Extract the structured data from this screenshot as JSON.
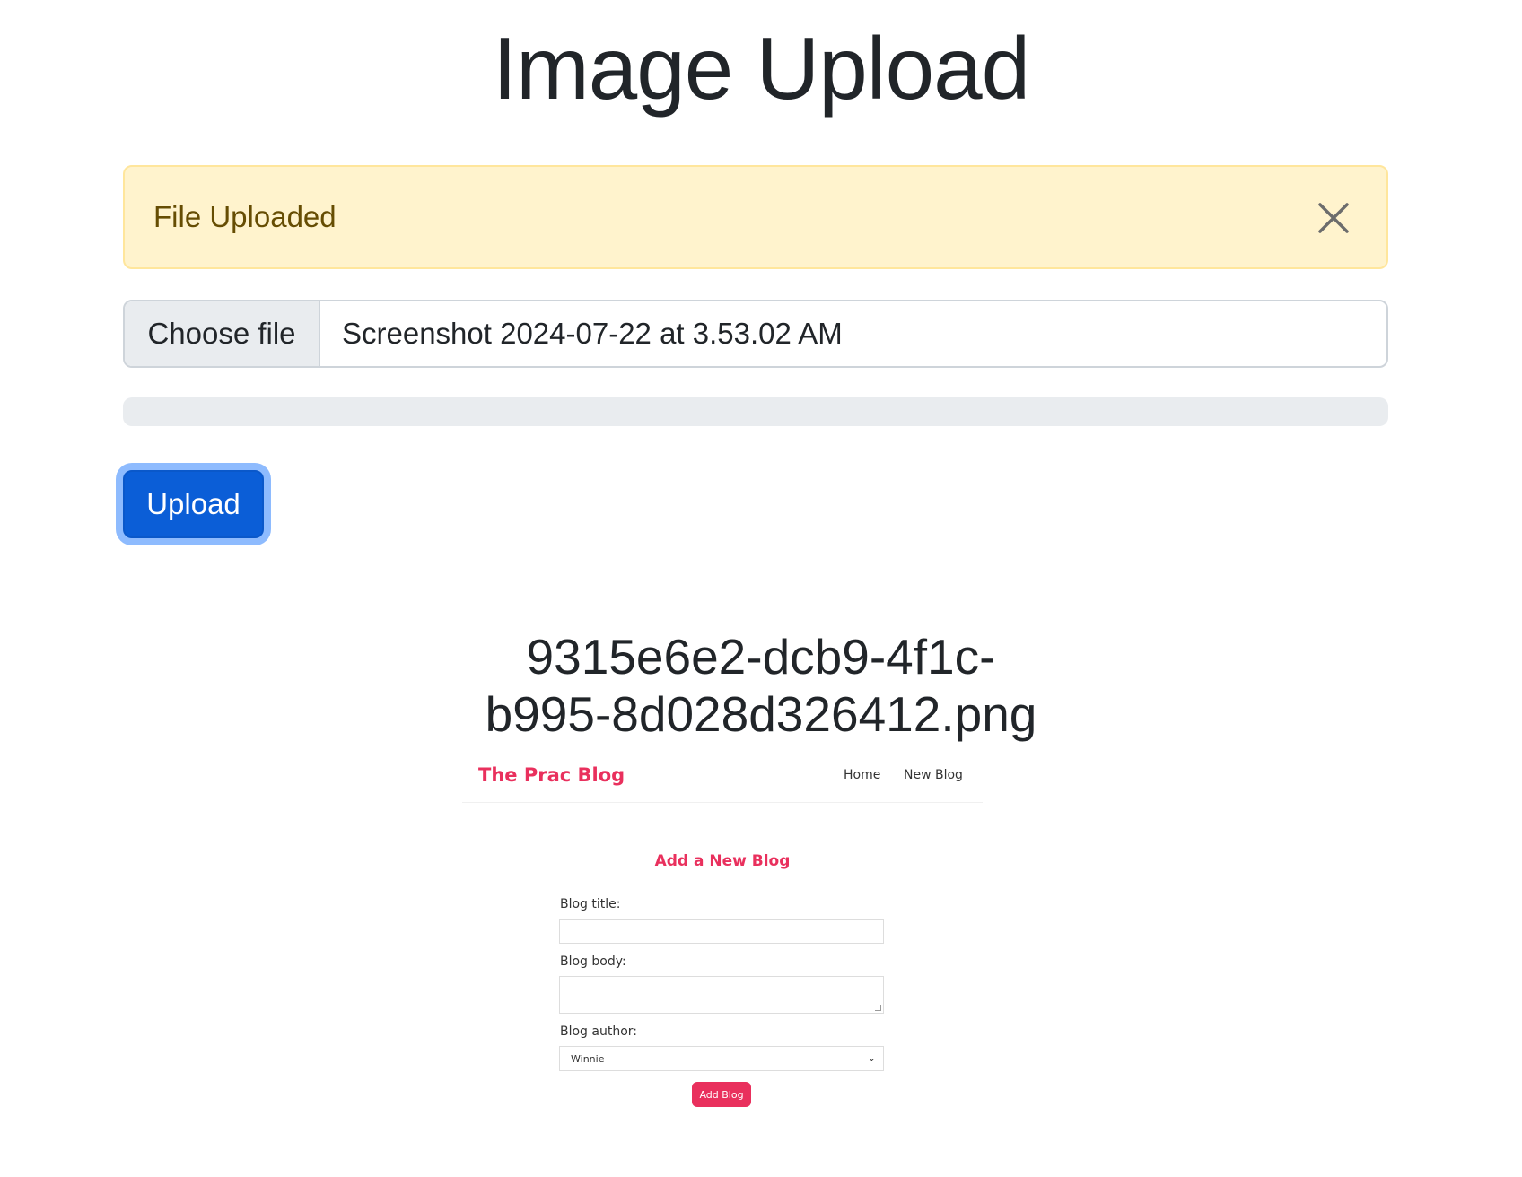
{
  "page": {
    "title": "Image Upload"
  },
  "alert": {
    "message": "File Uploaded",
    "close_icon": "close-icon"
  },
  "file_input": {
    "button_label": "Choose file",
    "file_name": "Screenshot 2024-07-22 at 3.53.02 AM"
  },
  "progress": {
    "percent": 0
  },
  "upload_button": {
    "label": "Upload"
  },
  "uploaded_file": {
    "line1": "9315e6e2-dcb9-4f1c-",
    "line2": "b995-8d028d326412.png"
  },
  "preview": {
    "brand": "The Prac Blog",
    "nav": {
      "home": "Home",
      "new_blog": "New Blog"
    },
    "heading": "Add a New Blog",
    "title_label": "Blog title:",
    "body_label": "Blog body:",
    "author_label": "Blog author:",
    "author_selected": "Winnie",
    "add_button": "Add Blog",
    "accent_color": "#e9305d"
  }
}
